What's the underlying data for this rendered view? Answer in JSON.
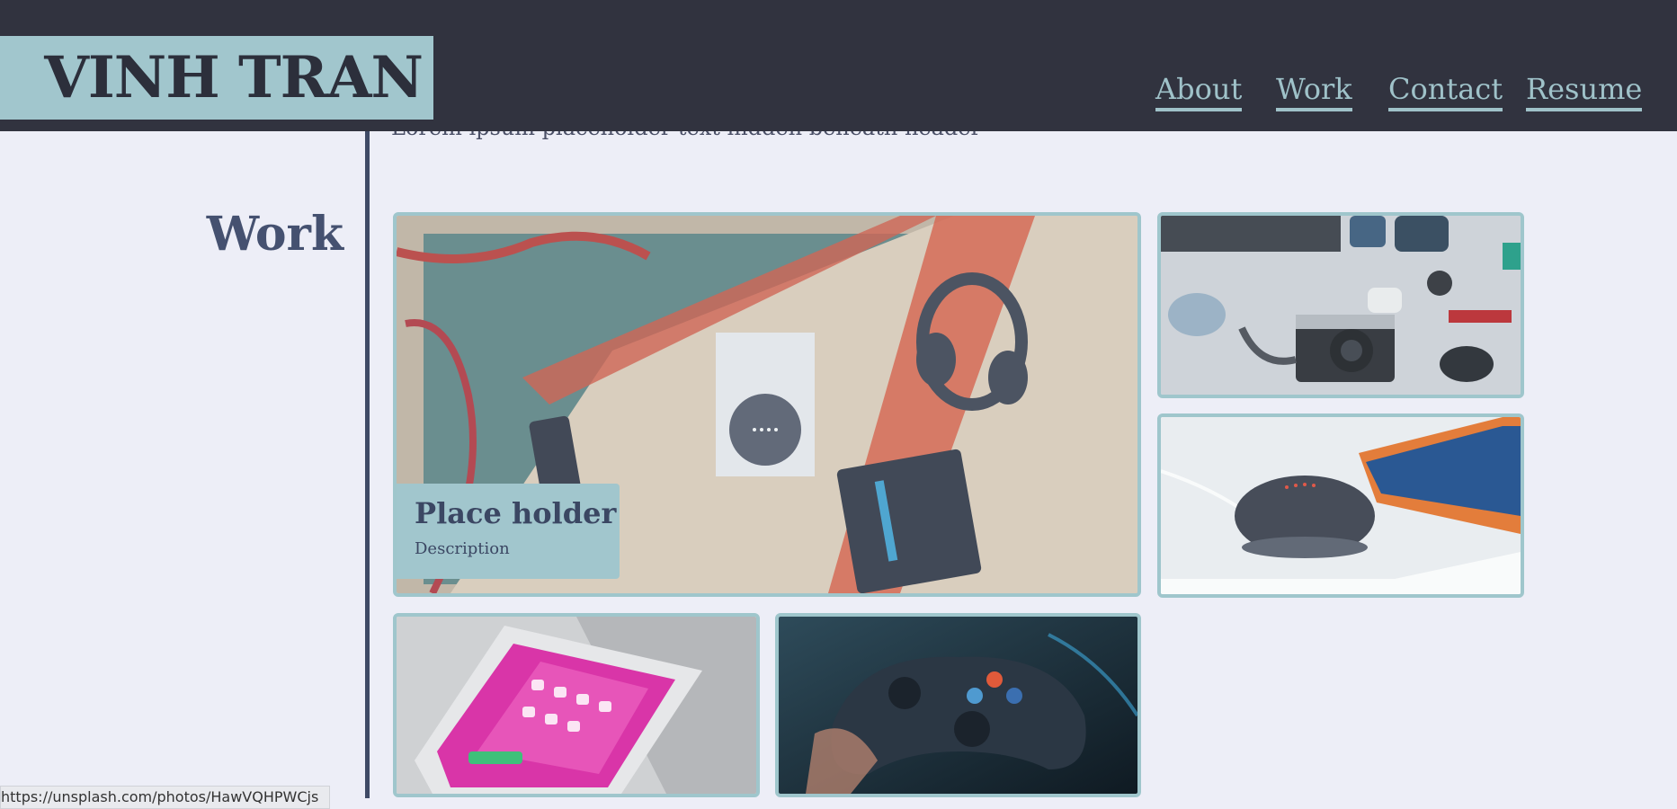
{
  "header": {
    "logo_text": "VINH TRAN",
    "nav": [
      "About",
      "Work",
      "Contact",
      "Resume"
    ]
  },
  "work": {
    "section_title": "Work",
    "featured": {
      "title": "Place holder",
      "description": "Description"
    }
  },
  "statusbar": {
    "url": "https://unsplash.com/photos/HawVQHPWCjs"
  },
  "colors": {
    "header_bg": "#31333f",
    "accent": "#a1c6cd",
    "page_bg": "#edeef7",
    "title_text": "#455170"
  }
}
